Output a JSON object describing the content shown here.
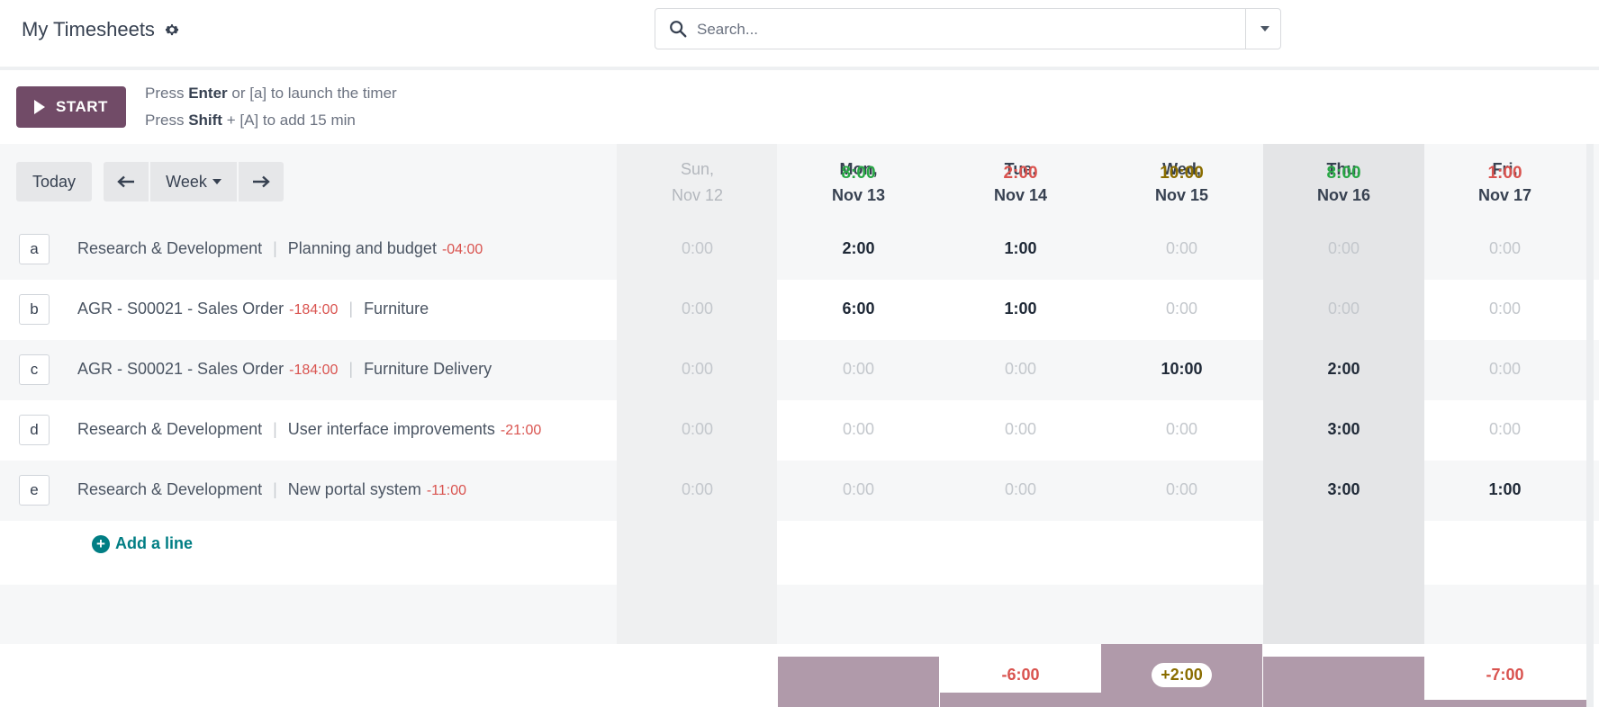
{
  "header": {
    "title": "My Timesheets",
    "search_placeholder": "Search..."
  },
  "timer": {
    "start_label": "START",
    "hint1_a": "Press ",
    "hint1_b": "Enter",
    "hint1_c": " or [a] to launch the timer",
    "hint2_a": "Press ",
    "hint2_b": "Shift",
    "hint2_c": " + [A] to add 15 min"
  },
  "nav": {
    "today": "Today",
    "week": "Week"
  },
  "days": [
    {
      "dow": "Sun,",
      "date": "Nov 12"
    },
    {
      "dow": "Mon,",
      "date": "Nov 13"
    },
    {
      "dow": "Tue,",
      "date": "Nov 14"
    },
    {
      "dow": "Wed,",
      "date": "Nov 15"
    },
    {
      "dow": "Thu,",
      "date": "Nov 16"
    },
    {
      "dow": "Fri,",
      "date": "Nov 17"
    }
  ],
  "rows": [
    {
      "key": "a",
      "project": "Research & Development",
      "project_neg": "",
      "task": "Planning and budget",
      "task_neg": "-04:00",
      "cells": [
        "0:00",
        "2:00",
        "1:00",
        "0:00",
        "0:00",
        "0:00"
      ]
    },
    {
      "key": "b",
      "project": "AGR - S00021 - Sales Order",
      "project_neg": "-184:00",
      "task": "Furniture",
      "task_neg": "",
      "cells": [
        "0:00",
        "6:00",
        "1:00",
        "0:00",
        "0:00",
        "0:00"
      ]
    },
    {
      "key": "c",
      "project": "AGR - S00021 - Sales Order",
      "project_neg": "-184:00",
      "task": "Furniture Delivery",
      "task_neg": "",
      "cells": [
        "0:00",
        "0:00",
        "0:00",
        "10:00",
        "2:00",
        "0:00"
      ]
    },
    {
      "key": "d",
      "project": "Research & Development",
      "project_neg": "",
      "task": "User interface improvements",
      "task_neg": "-21:00",
      "cells": [
        "0:00",
        "0:00",
        "0:00",
        "0:00",
        "3:00",
        "0:00"
      ]
    },
    {
      "key": "e",
      "project": "Research & Development",
      "project_neg": "",
      "task": "New portal system",
      "task_neg": "-11:00",
      "cells": [
        "0:00",
        "0:00",
        "0:00",
        "0:00",
        "3:00",
        "1:00"
      ]
    }
  ],
  "add_line": "Add a line",
  "totals": [
    "",
    "8:00",
    "2:00",
    "10:00",
    "8:00",
    "1:00"
  ],
  "overtime": [
    "",
    "",
    "-6:00",
    "+2:00",
    "",
    "-7:00"
  ],
  "colors": {
    "brand": "#714b67",
    "link": "#017e84",
    "ok": "#28a745",
    "under": "#d9534f",
    "over": "#8a6d00",
    "bar": "#b09aaa"
  }
}
